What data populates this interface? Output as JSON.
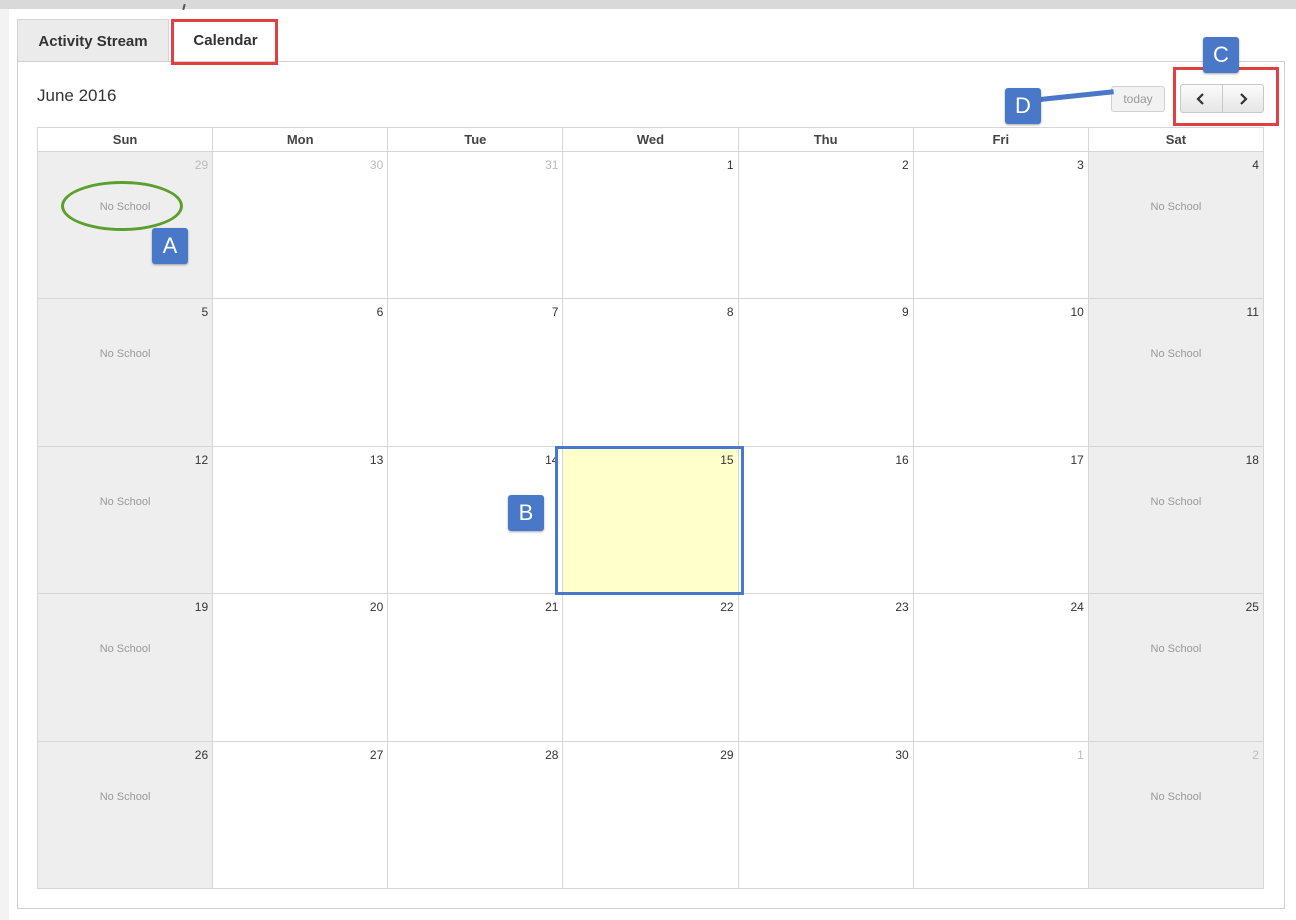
{
  "tabs": [
    {
      "label": "Activity Stream"
    },
    {
      "label": "Calendar"
    }
  ],
  "calendar": {
    "title": "June 2016",
    "today_label": "today",
    "prev_icon": "chevron-left-icon",
    "next_icon": "chevron-right-icon",
    "weekdays": [
      "Sun",
      "Mon",
      "Tue",
      "Wed",
      "Thu",
      "Fri",
      "Sat"
    ],
    "weeks": [
      [
        {
          "d": "29",
          "other": true,
          "event": "No School"
        },
        {
          "d": "30",
          "other": true
        },
        {
          "d": "31",
          "other": true
        },
        {
          "d": "1"
        },
        {
          "d": "2"
        },
        {
          "d": "3"
        },
        {
          "d": "4",
          "event": "No School"
        }
      ],
      [
        {
          "d": "5",
          "event": "No School"
        },
        {
          "d": "6"
        },
        {
          "d": "7"
        },
        {
          "d": "8"
        },
        {
          "d": "9"
        },
        {
          "d": "10"
        },
        {
          "d": "11",
          "event": "No School"
        }
      ],
      [
        {
          "d": "12",
          "event": "No School"
        },
        {
          "d": "13"
        },
        {
          "d": "14"
        },
        {
          "d": "15",
          "today": true
        },
        {
          "d": "16"
        },
        {
          "d": "17"
        },
        {
          "d": "18",
          "event": "No School"
        }
      ],
      [
        {
          "d": "19",
          "event": "No School"
        },
        {
          "d": "20"
        },
        {
          "d": "21"
        },
        {
          "d": "22"
        },
        {
          "d": "23"
        },
        {
          "d": "24"
        },
        {
          "d": "25",
          "event": "No School"
        }
      ],
      [
        {
          "d": "26",
          "event": "No School"
        },
        {
          "d": "27"
        },
        {
          "d": "28"
        },
        {
          "d": "29"
        },
        {
          "d": "30"
        },
        {
          "d": "1",
          "other": true
        },
        {
          "d": "2",
          "other": true,
          "event": "No School"
        }
      ]
    ]
  },
  "annotations": {
    "a": "A",
    "b": "B",
    "c": "C",
    "d": "D"
  },
  "colors": {
    "highlight_red": "#e04040",
    "highlight_blue": "#4a78c8",
    "highlight_green": "#5aa02c",
    "today_fill": "#ffffcc",
    "weekend_fill": "#eeeeee"
  }
}
